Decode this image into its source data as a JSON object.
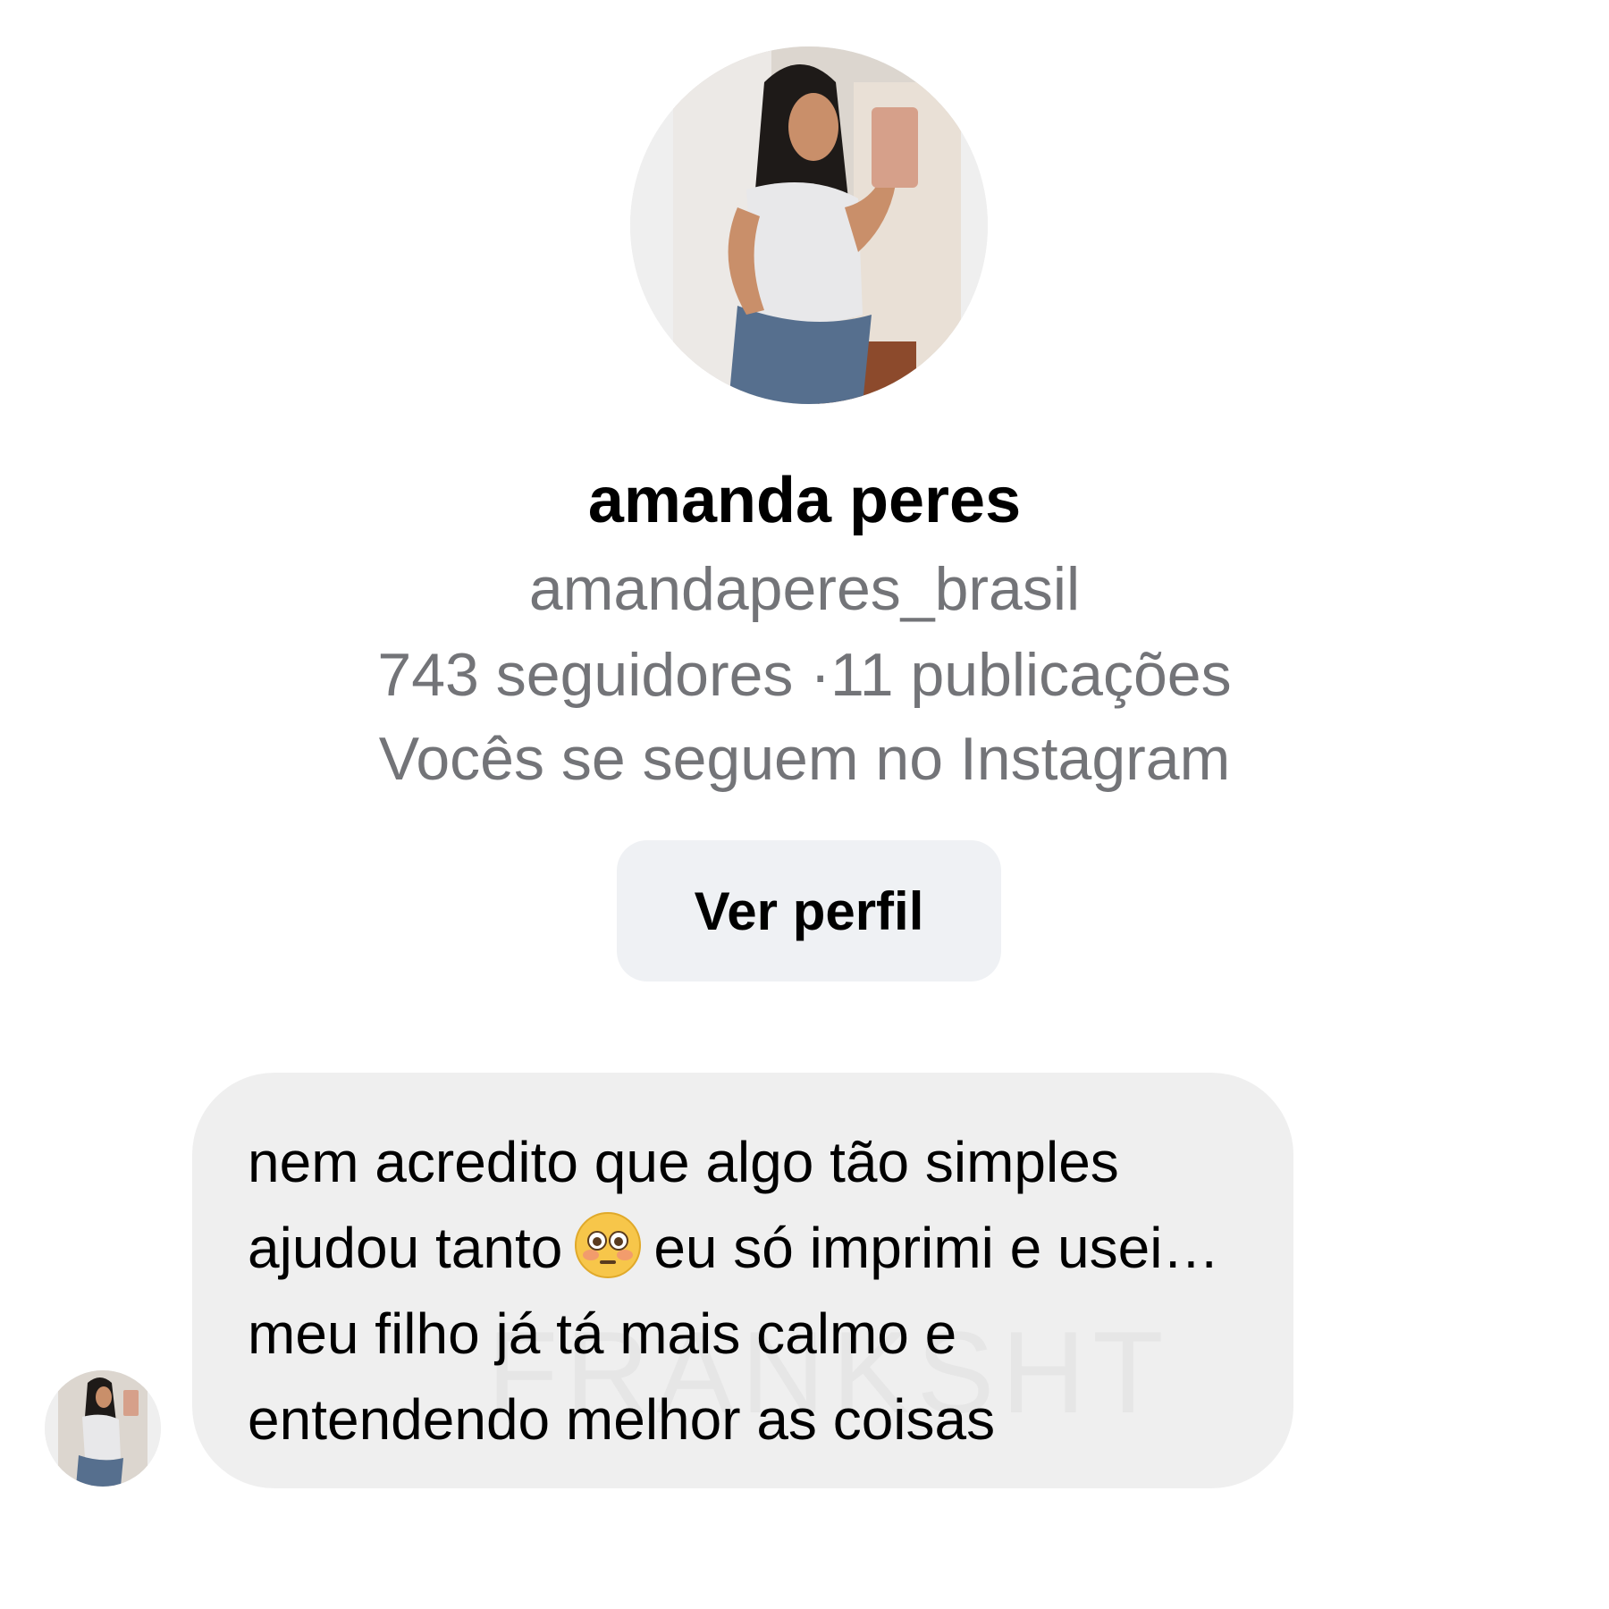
{
  "profile": {
    "avatar_icon": "profile-photo-avatar",
    "name": "amanda peres",
    "username": "amandaperes_brasil",
    "stats": "743 seguidores ·11 publicações",
    "mutual": "Vocês se seguem no Instagram",
    "view_profile_label": "Ver perfil"
  },
  "message": {
    "sender_avatar_icon": "sender-avatar",
    "text_before_emoji": "nem acredito que algo tão simples ajudou tanto",
    "emoji": "flushed-face-emoji",
    "text_after_emoji": "eu só imprimi e usei… meu filho já tá mais calmo e entendendo melhor as coisas",
    "watermark": "FRANKSHT"
  },
  "colors": {
    "secondary_text": "#737478",
    "button_bg": "#eff1f4",
    "bubble_bg": "#efefef"
  }
}
